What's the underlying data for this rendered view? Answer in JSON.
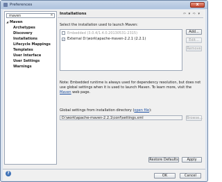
{
  "window": {
    "title": "Preferences",
    "close_glyph": "x"
  },
  "search": {
    "value": "maven",
    "clear_glyph": "×"
  },
  "tree": {
    "root": "Maven",
    "items": [
      "Archetypes",
      "Discovery",
      "Installations",
      "Lifecycle Mappings",
      "Templates",
      "User Interface",
      "User Settings",
      "Warnings"
    ]
  },
  "page": {
    "title": "Installations",
    "nav_glyphs": "⇦ ▾ ⇨ ▾",
    "select_label": "Select the installation used to launch Maven:",
    "installations": [
      {
        "label": "Embedded (3.0.4/1.4.0.20130531-2315)",
        "checked": false,
        "enabled": false
      },
      {
        "label": "External D:\\work\\apache-maven-2.2.1 (2.2.1)",
        "checked": true,
        "enabled": true
      }
    ],
    "buttons": {
      "add": "Add...",
      "edit": "Edit...",
      "remove": "Remove"
    },
    "note_prefix": "Note: Embedded runtime is always used for dependency resolution, but does not use global settings when it is used to launch Maven. To learn more, visit the ",
    "note_link": "Maven",
    "note_suffix": " web page.",
    "global_label_prefix": "Global settings from installation directory (",
    "global_label_link": "open file",
    "global_label_suffix": "):",
    "global_path": "D:\\work\\apache-maven-2.2.1\\conf\\settings.xml",
    "browse": "Browse...",
    "restore_defaults": "Restore Defaults",
    "apply": "Apply"
  },
  "dialog": {
    "ok": "OK",
    "cancel": "Cancel",
    "help_glyph": "?"
  }
}
